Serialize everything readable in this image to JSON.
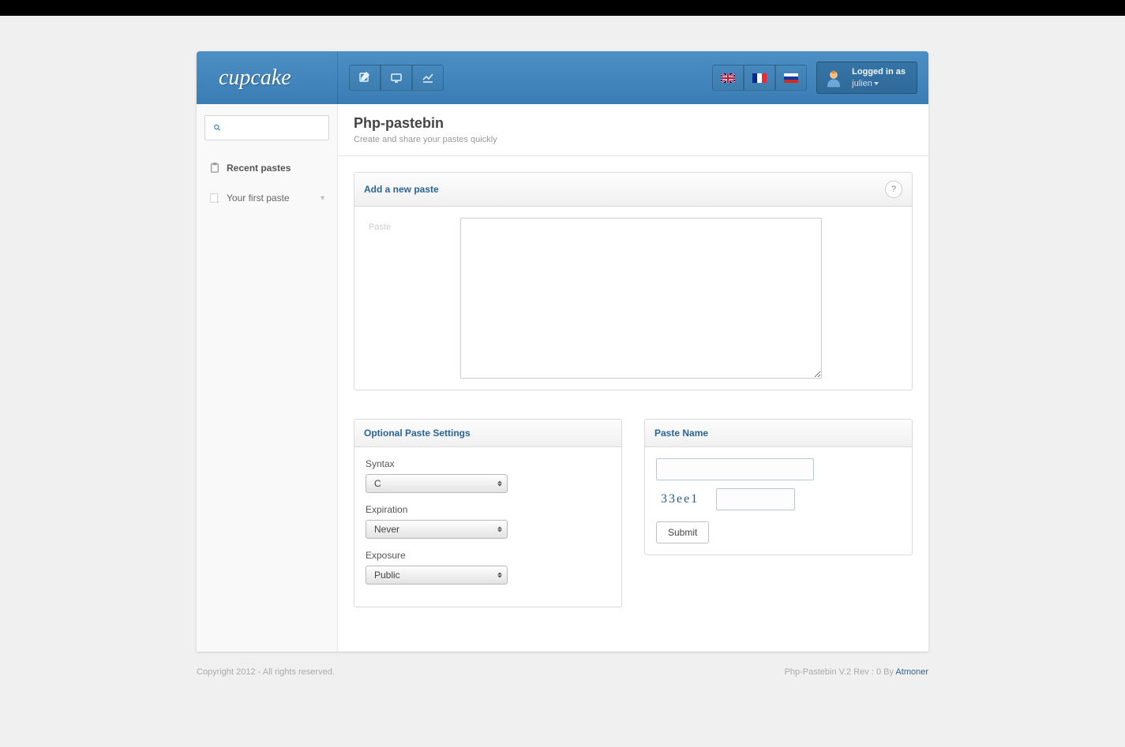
{
  "brand": "cupcake",
  "user": {
    "label": "Logged in as",
    "name": "julien"
  },
  "sidebar": {
    "section_title": "Recent pastes",
    "items": [
      "Your first paste"
    ]
  },
  "page": {
    "title": "Php-pastebin",
    "subtitle": "Create and share your pastes quickly"
  },
  "panels": {
    "add": {
      "title": "Add a new paste",
      "help": "?",
      "paste_label": "Paste"
    },
    "settings": {
      "title": "Optional Paste Settings",
      "syntax_label": "Syntax",
      "syntax_value": "C",
      "expiration_label": "Expiration",
      "expiration_value": "Never",
      "exposure_label": "Exposure",
      "exposure_value": "Public"
    },
    "name": {
      "title": "Paste Name",
      "captcha": "33ee1",
      "submit": "Submit"
    }
  },
  "footer": {
    "left": "Copyright 2012 - All rights reserved.",
    "right_prefix": "Php-Pastebin V.2 Rev : 0 By ",
    "right_link": "Atmoner"
  }
}
